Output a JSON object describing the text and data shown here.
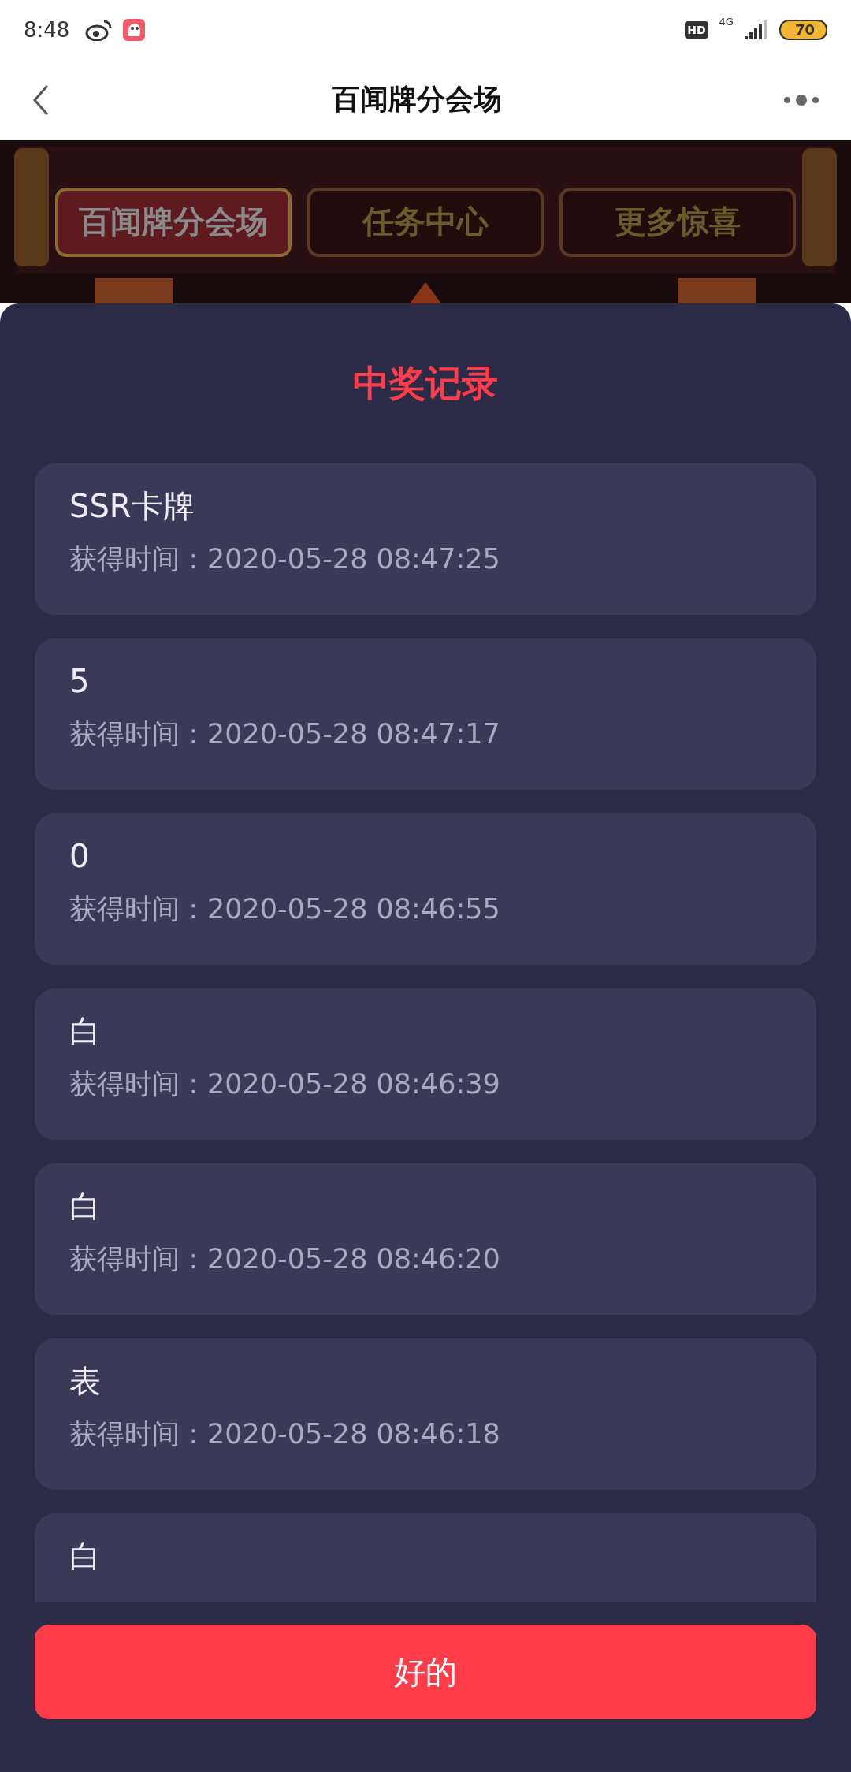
{
  "status_bar": {
    "time": "8:48",
    "hd": "HD",
    "network": "4G",
    "battery": "70"
  },
  "nav": {
    "title": "百闻牌分会场"
  },
  "banner_tabs": [
    {
      "label": "百闻牌分会场",
      "selected": true
    },
    {
      "label": "任务中心",
      "selected": false
    },
    {
      "label": "更多惊喜",
      "selected": false
    }
  ],
  "dialog": {
    "title": "中奖记录",
    "records": [
      {
        "prize": "SSR卡牌",
        "time": "获得时间：2020-05-28 08:47:25"
      },
      {
        "prize": "5",
        "time": "获得时间：2020-05-28 08:47:17"
      },
      {
        "prize": "0",
        "time": "获得时间：2020-05-28 08:46:55"
      },
      {
        "prize": "白",
        "time": "获得时间：2020-05-28 08:46:39"
      },
      {
        "prize": "白",
        "time": "获得时间：2020-05-28 08:46:20"
      },
      {
        "prize": "表",
        "time": "获得时间：2020-05-28 08:46:18"
      },
      {
        "prize": "白"
      }
    ],
    "confirm_button": "好的"
  }
}
